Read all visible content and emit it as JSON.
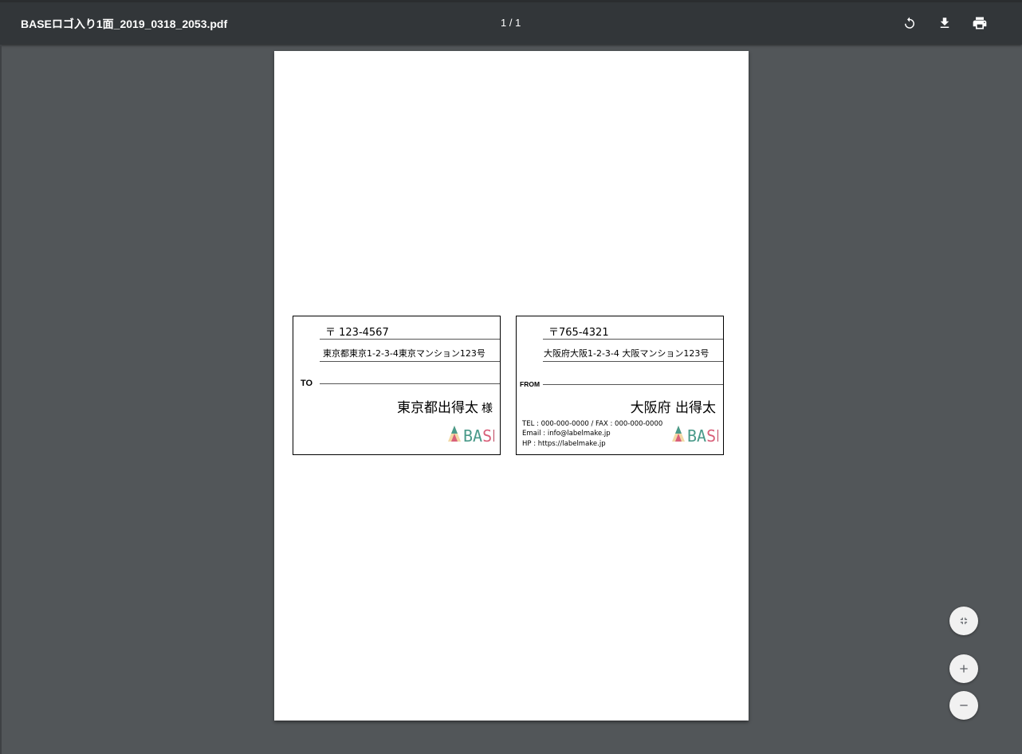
{
  "toolbar": {
    "title": "BASEロゴ入り1面_2019_0318_2053.pdf",
    "page_indicator": "1 / 1",
    "rotate_icon": "rotate-icon",
    "download_icon": "download-icon",
    "print_icon": "print-icon"
  },
  "document": {
    "to_label": {
      "postal": "〒 123-4567",
      "address": "東京都東京1-2-3-4東京マンション123号",
      "role": "TO",
      "name": "東京都出得太",
      "honorific": "様",
      "logo_text": "BASE"
    },
    "from_label": {
      "postal": "〒765-4321",
      "address": "大阪府大阪1-2-3-4 大阪マンション123号",
      "role": "FROM",
      "name": "大阪府 出得太",
      "tel_fax": "TEL : 000-000-0000 / FAX : 000-000-0000",
      "email": "Email : info@labelmake.jp",
      "hp": "HP : https://labelmake.jp",
      "logo_text": "BASE"
    }
  },
  "zoom_controls": {
    "fit_icon": "fit-to-page-icon",
    "zoom_in_icon": "zoom-in-icon",
    "zoom_out_icon": "zoom-out-icon"
  },
  "colors": {
    "toolbar_bg": "#323639",
    "viewer_bg": "#525659",
    "logo_teal": "#4a9a8a",
    "logo_pink": "#d9607a",
    "logo_red": "#b83a55"
  }
}
